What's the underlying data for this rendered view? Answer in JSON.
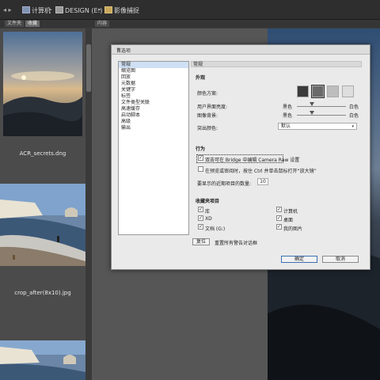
{
  "topbar": {
    "crumb_computer": "计算机",
    "crumb_design": "DESIGN (E:)",
    "crumb_photos": "影像捕捉"
  },
  "tabs": {
    "folders": "文件夹",
    "favorites": "收藏",
    "content": "内容"
  },
  "thumbnails": [
    {
      "caption": "ACR_secrets.dng"
    },
    {
      "caption": "crop_after(8x10).jpg"
    }
  ],
  "dialog": {
    "title": "首选项",
    "nav": [
      "常规",
      "缩览图",
      "回放",
      "元数据",
      "关键字",
      "标签",
      "文件类型关联",
      "高速缓存",
      "启动脚本",
      "高级",
      "输出"
    ],
    "section_general": "常规",
    "section_appearance": "外观",
    "color_scheme_label": "颜色方案:",
    "ui_brightness_label": "用户界面亮度:",
    "image_bg_label": "图像背景:",
    "black": "黑色",
    "white": "白色",
    "accent_color_label": "突出颜色:",
    "accent_color_value": "默认",
    "section_behavior": "行为",
    "behavior_1": "双击可在 Bridge 中编辑 Camera Raw 设置",
    "behavior_2": "在预览或审阅时，按住 Ctrl 并单击鼠标打开“放大镜”",
    "recent_items_label": "要显示的近期项目的数量:",
    "recent_items_value": "10",
    "section_favorites": "收藏夹项目",
    "fav_left": [
      "库",
      "XD",
      "文档 (G:)"
    ],
    "fav_right": [
      "计算机",
      "桌面",
      "我的图片"
    ],
    "reset_button": "复位",
    "reset_text": "重置所有警告对话框",
    "ok_button": "确定",
    "cancel_button": "取消"
  },
  "ui_colors": {
    "bridge_bg": "#3c3c3c",
    "dialog_bg": "#eaeaea",
    "nav_selection": "#cfe0f5",
    "ok_border": "#3d6fb0"
  },
  "accent_colors": {
    "swatch_1": "#3b3b3b",
    "swatch_2": "#6a6a6a",
    "swatch_3": "#bdbdbd",
    "swatch_4": "#dedede"
  }
}
